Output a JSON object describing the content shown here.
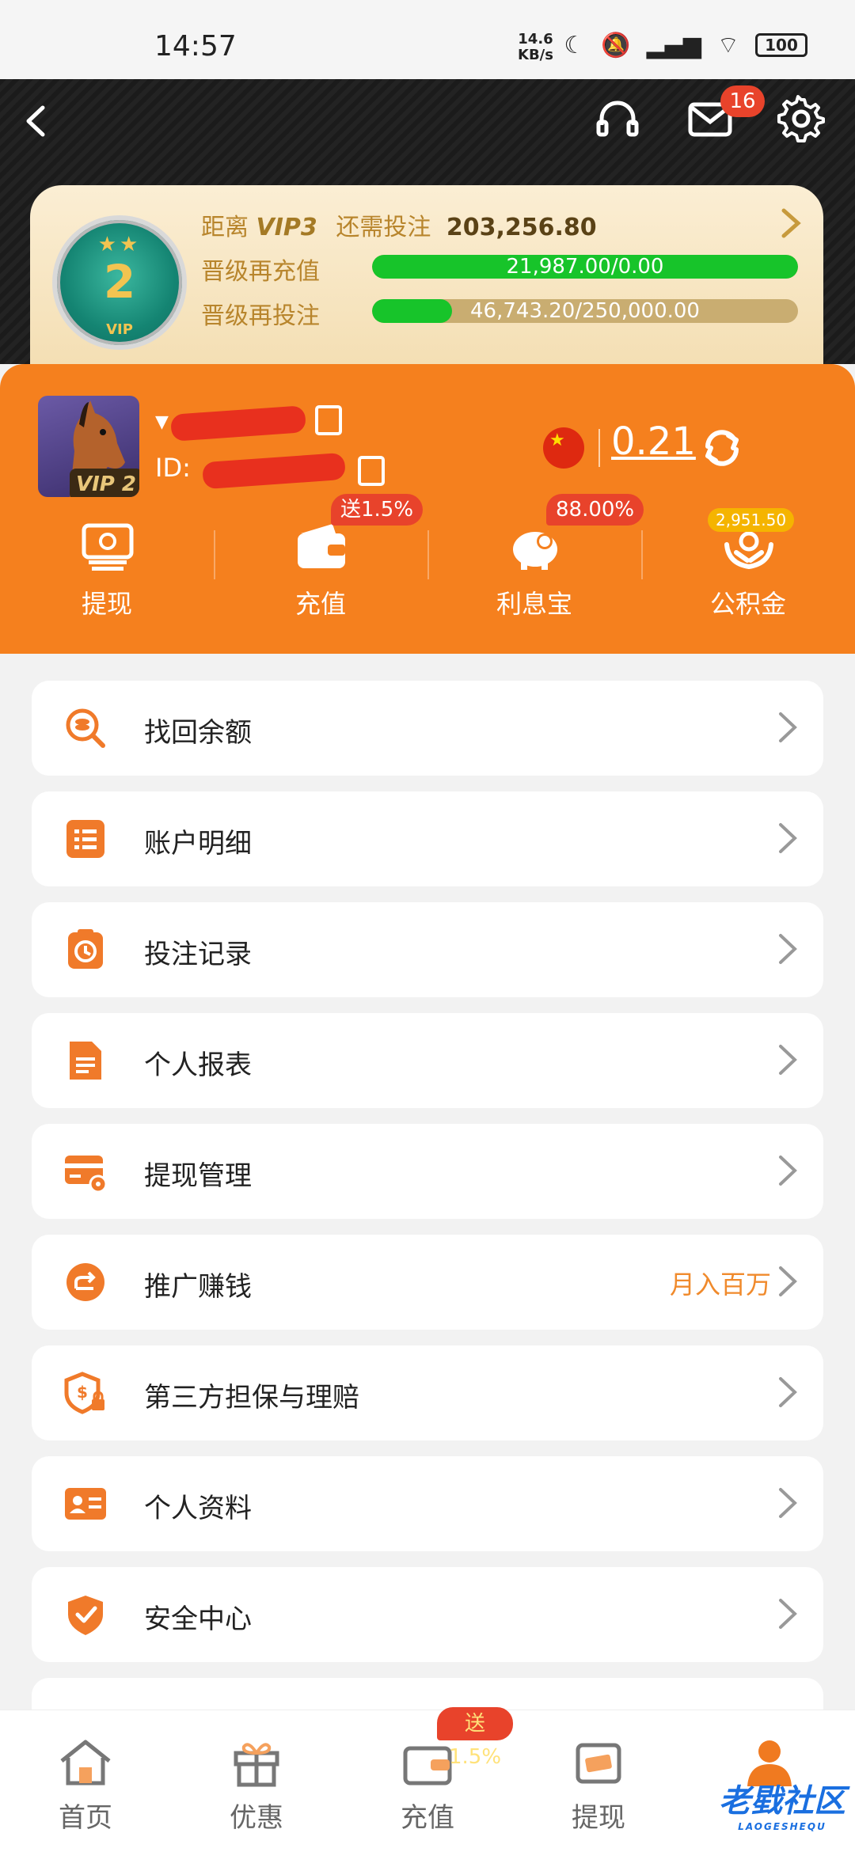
{
  "status_bar": {
    "time": "14:57",
    "net_speed_value": "14.6",
    "net_speed_unit": "KB/s",
    "battery": "100"
  },
  "header": {
    "mail_badge": "16"
  },
  "vip": {
    "medal_level": "2",
    "medal_vip_text": "VIP",
    "target_prefix": "距离",
    "target_level": "VIP3",
    "need_label": "还需投注",
    "need_amount": "203,256.80",
    "recharge_label": "晋级再充值",
    "recharge_value": "21,987.00/0.00",
    "recharge_progress": 1.0,
    "bet_label": "晋级再投注",
    "bet_value": "46,743.20/250,000.00",
    "bet_progress": 0.187
  },
  "profile": {
    "avatar_vip": "VIP 2",
    "id_prefix": "ID:",
    "balance": "0.21"
  },
  "quick_actions": [
    {
      "label": "提现",
      "icon": "withdraw-cash-icon"
    },
    {
      "label": "充值",
      "icon": "wallet-icon",
      "badge": "送1.5%"
    },
    {
      "label": "利息宝",
      "icon": "piggy-bank-icon",
      "badge": "88.00%"
    },
    {
      "label": "公积金",
      "icon": "hands-coin-icon",
      "badge": "2,951.50"
    }
  ],
  "menu": [
    {
      "label": "找回余额",
      "icon": "coin-search-icon"
    },
    {
      "label": "账户明细",
      "icon": "list-icon"
    },
    {
      "label": "投注记录",
      "icon": "clock-clipboard-icon"
    },
    {
      "label": "个人报表",
      "icon": "document-icon"
    },
    {
      "label": "提现管理",
      "icon": "card-gear-icon"
    },
    {
      "label": "推广赚钱",
      "icon": "share-icon",
      "extra": "月入百万"
    },
    {
      "label": "第三方担保与理赔",
      "icon": "shield-lock-icon"
    },
    {
      "label": "个人资料",
      "icon": "id-card-icon"
    },
    {
      "label": "安全中心",
      "icon": "shield-check-icon"
    }
  ],
  "bottom_nav": [
    {
      "label": "首页",
      "icon": "home-icon"
    },
    {
      "label": "优惠",
      "icon": "gift-icon"
    },
    {
      "label": "充值",
      "icon": "wallet-icon",
      "badge": "送1.5%"
    },
    {
      "label": "提现",
      "icon": "withdraw-icon"
    },
    {
      "label": "我的",
      "icon": "user-icon",
      "active": true
    }
  ],
  "watermark": {
    "main": "老戥社区",
    "sub": "LAOGESHEQU"
  },
  "colors": {
    "orange": "#f5801e",
    "progress_green": "#17c42a",
    "badge_red": "#e8432b"
  }
}
